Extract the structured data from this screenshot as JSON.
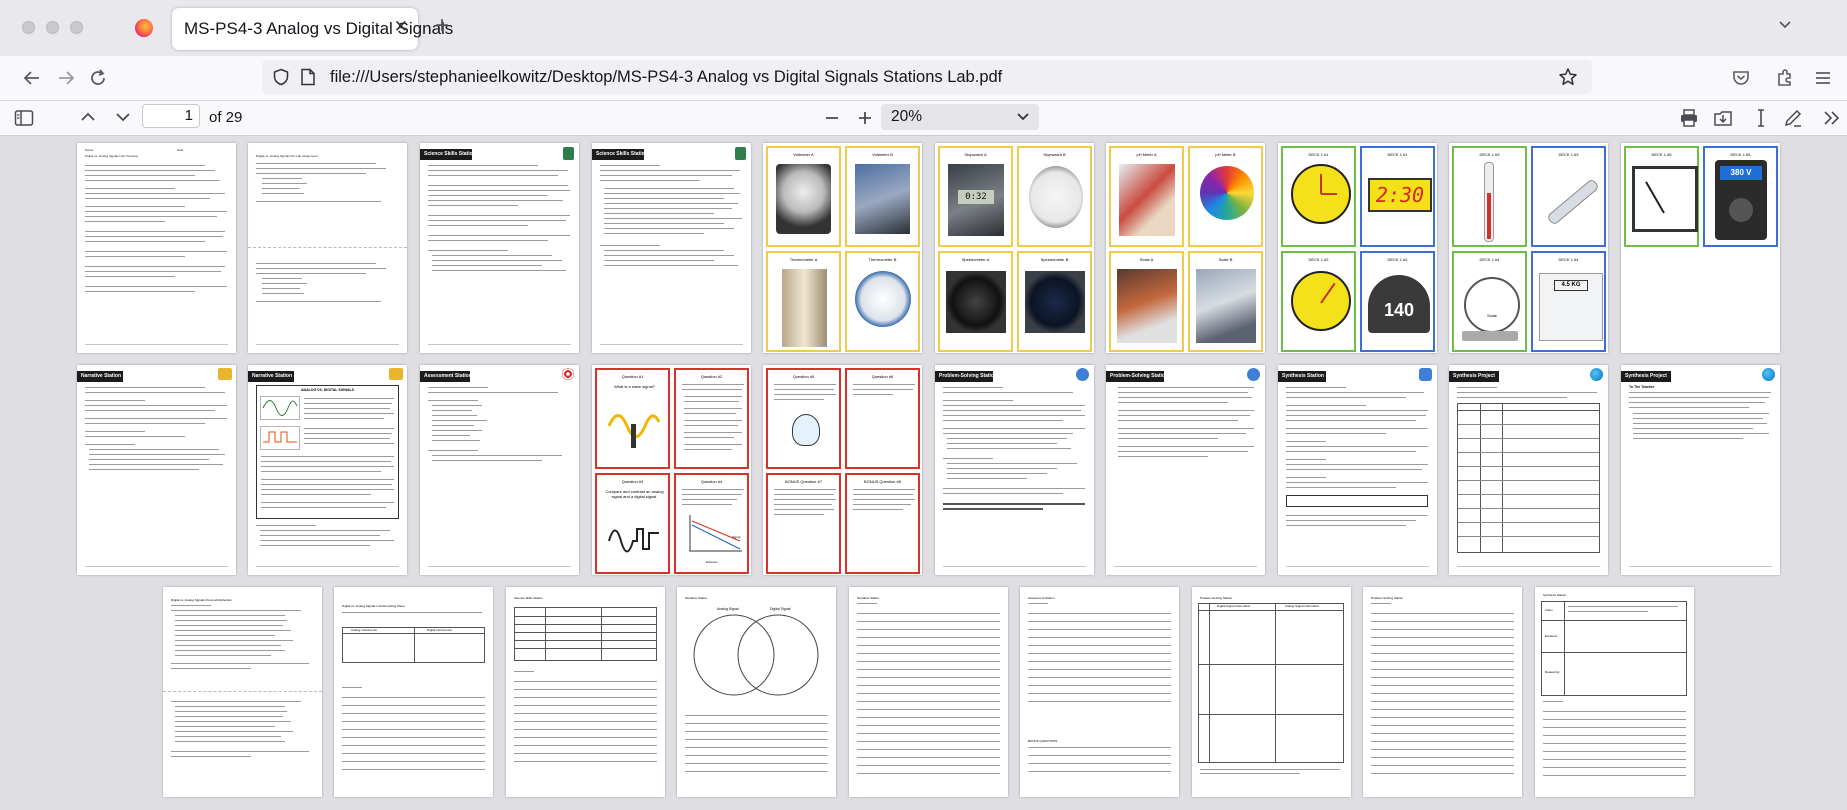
{
  "browser": {
    "tab_title": "MS-PS4-3 Analog vs Digital Signals",
    "url": "file:///Users/stephanieelkowitz/Desktop/MS-PS4-3 Analog vs Digital Signals Stations Lab.pdf"
  },
  "pdf_toolbar": {
    "current_page": "1",
    "of_pages": "of 29",
    "zoom": "20%"
  },
  "thumbs": {
    "p1": {
      "title": "Digital vs. Analog Signals Lab Overview",
      "name": "Name:",
      "date": "Date:"
    },
    "p2": {
      "title": "Digital vs. Analog Signals Pre-Lab Assignment"
    },
    "p3": {
      "header": "Science Skills Station"
    },
    "p4": {
      "header": "Science Skills Station"
    },
    "p5": {
      "a": "Voltmeter A",
      "b": "Voltmeter B",
      "c": "Thermometer A",
      "d": "Thermometer B"
    },
    "p6": {
      "a": "Stopwatch A",
      "b": "Stopwatch B",
      "c": "Speedometer A",
      "d": "Speedometer B",
      "lcd": "0:32"
    },
    "p7": {
      "a": "pH Meter A",
      "b": "pH Meter B",
      "c": "Scale A",
      "d": "Scale B"
    },
    "p8": {
      "a": "DECK 1 #1",
      "b": "DECK 1 #1",
      "c": "DECK 1 #2",
      "d": "DECK 1 #2",
      "clock": "2:30",
      "speed": "140"
    },
    "p9": {
      "a": "DECK 1 #3",
      "b": "DECK 1 #3",
      "c": "DECK 1 #4",
      "d": "DECK 1 #4",
      "scale": "Scale",
      "kg": "4.5 KG"
    },
    "p10": {
      "a": "DECK 1 #5",
      "b": "DECK 1 #5",
      "volts": "380 V"
    },
    "p11": {
      "header": "Narrative Station"
    },
    "p12": {
      "header": "Narrative Station",
      "article": "ANALOG VS. DIGITAL SIGNALS"
    },
    "p13": {
      "header": "Assessment Station"
    },
    "p14": {
      "q1": "Question #1",
      "q1t": "What is a wave signal?",
      "q3": "Question #3",
      "q3t": "Compare and contrast an analog signal and a digital signal.",
      "q2": "Question #2",
      "q4": "Question #4",
      "sig": "Signal",
      "dist": "Distance"
    },
    "p15": {
      "q5": "Question #5",
      "q6": "Question #6",
      "b7": "BONUS Question #7",
      "b8": "BONUS Question #8"
    },
    "p16": {
      "header": "Problem-Solving Station"
    },
    "p17": {
      "header": "Problem-Solving Station"
    },
    "p18": {
      "header": "Synthesis Station"
    },
    "p19": {
      "header": "Synthesis Project"
    },
    "p20": {
      "header": "Synthesis Project",
      "sub": "To The Teacher"
    },
    "p21": {
      "title": "Digital vs. Analog Signals Post-Lab Reflection"
    },
    "p22": {
      "title": "Digital vs. Analog Signals Lab Recording Sheet",
      "col1": "Analog Instruments",
      "col2": "Digital Instruments"
    },
    "p23": {
      "title": "Science Skills Station"
    },
    "p24": {
      "title": "Narrative Station",
      "v1": "Analog Signal",
      "v2": "Digital Signal"
    },
    "p25": {
      "title": "Narrative Station"
    },
    "p26": {
      "title": "Assessment Station",
      "bonus": "BONUS QUESTIONS:"
    },
    "p27": {
      "title": "Problem-Solving Station",
      "c1": "Digital Signal Information",
      "c2": "Analog Signal Information"
    },
    "p28": {
      "title": "Problem-Solving Station"
    },
    "p29": {
      "title": "Synthesis Station",
      "claim": "Claim",
      "evidence": "Evidence",
      "reasoning": "Reasoning"
    }
  },
  "colors": {
    "card_yellow": "#f2c94c",
    "card_blue": "#3b6fd4",
    "card_green": "#6cc04a",
    "card_red": "#d9312c"
  }
}
